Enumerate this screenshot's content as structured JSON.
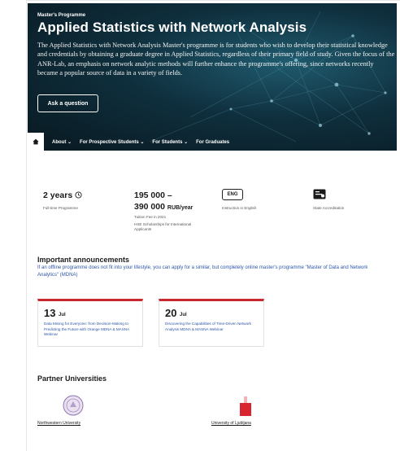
{
  "hero": {
    "label": "Master's Programme",
    "title": "Applied Statistics with Network Analysis",
    "description": "The Applied Statistics with Network Analysis Master's programme is for students who wish to develop their statistical knowledge and credentials by obtaining a graduate degree in Applied Statistics, regardless of their primary field of study. Given the focus of the ANR-Lab, an emphasis on network analytic methods will further enhance the programme's offering, since networks recently became a popular source of data in a variety of fields.",
    "ask_button": "Ask a question"
  },
  "nav": {
    "items": [
      "About",
      "For Prospective Students",
      "For Students",
      "For Graduates"
    ]
  },
  "stats": {
    "duration": {
      "value": "2 years",
      "caption": "Full-time Programme"
    },
    "fee": {
      "value_line1": "195 000 –",
      "value_line2": "390 000",
      "unit": "RUB/year",
      "caption1": "Tuition Fee in 2021",
      "caption2": "HSE Scholarships for International Applicants"
    },
    "language": {
      "badge": "ENG",
      "caption": "Instruction in English"
    },
    "accreditation": {
      "caption": "State Accreditation"
    }
  },
  "announcements": {
    "title": "Important announcements",
    "link_text": "If an offline programme does not fit into your lifestyle, you can apply for a similar, but completely online master's programme \"Master of Data and Network Analytics\" (MDNA)",
    "cards": [
      {
        "day": "13",
        "month": "Jul",
        "text": "Data Mining for Everyone: from Decision-Making to Predicting the Future with Orange MDNA & MASNA Webinar"
      },
      {
        "day": "20",
        "month": "Jul",
        "text": "Discovering the Capabilities of Time-Driven Network Analysis MDNA & MASNA Webinar"
      }
    ]
  },
  "partners": {
    "title": "Partner Universities",
    "items": [
      "Northwestern University",
      "University of Ljubljana"
    ]
  },
  "colors": {
    "accent_red": "#c8282e",
    "link_blue": "#2b56a6",
    "hero_dark": "#0f2f3d"
  }
}
